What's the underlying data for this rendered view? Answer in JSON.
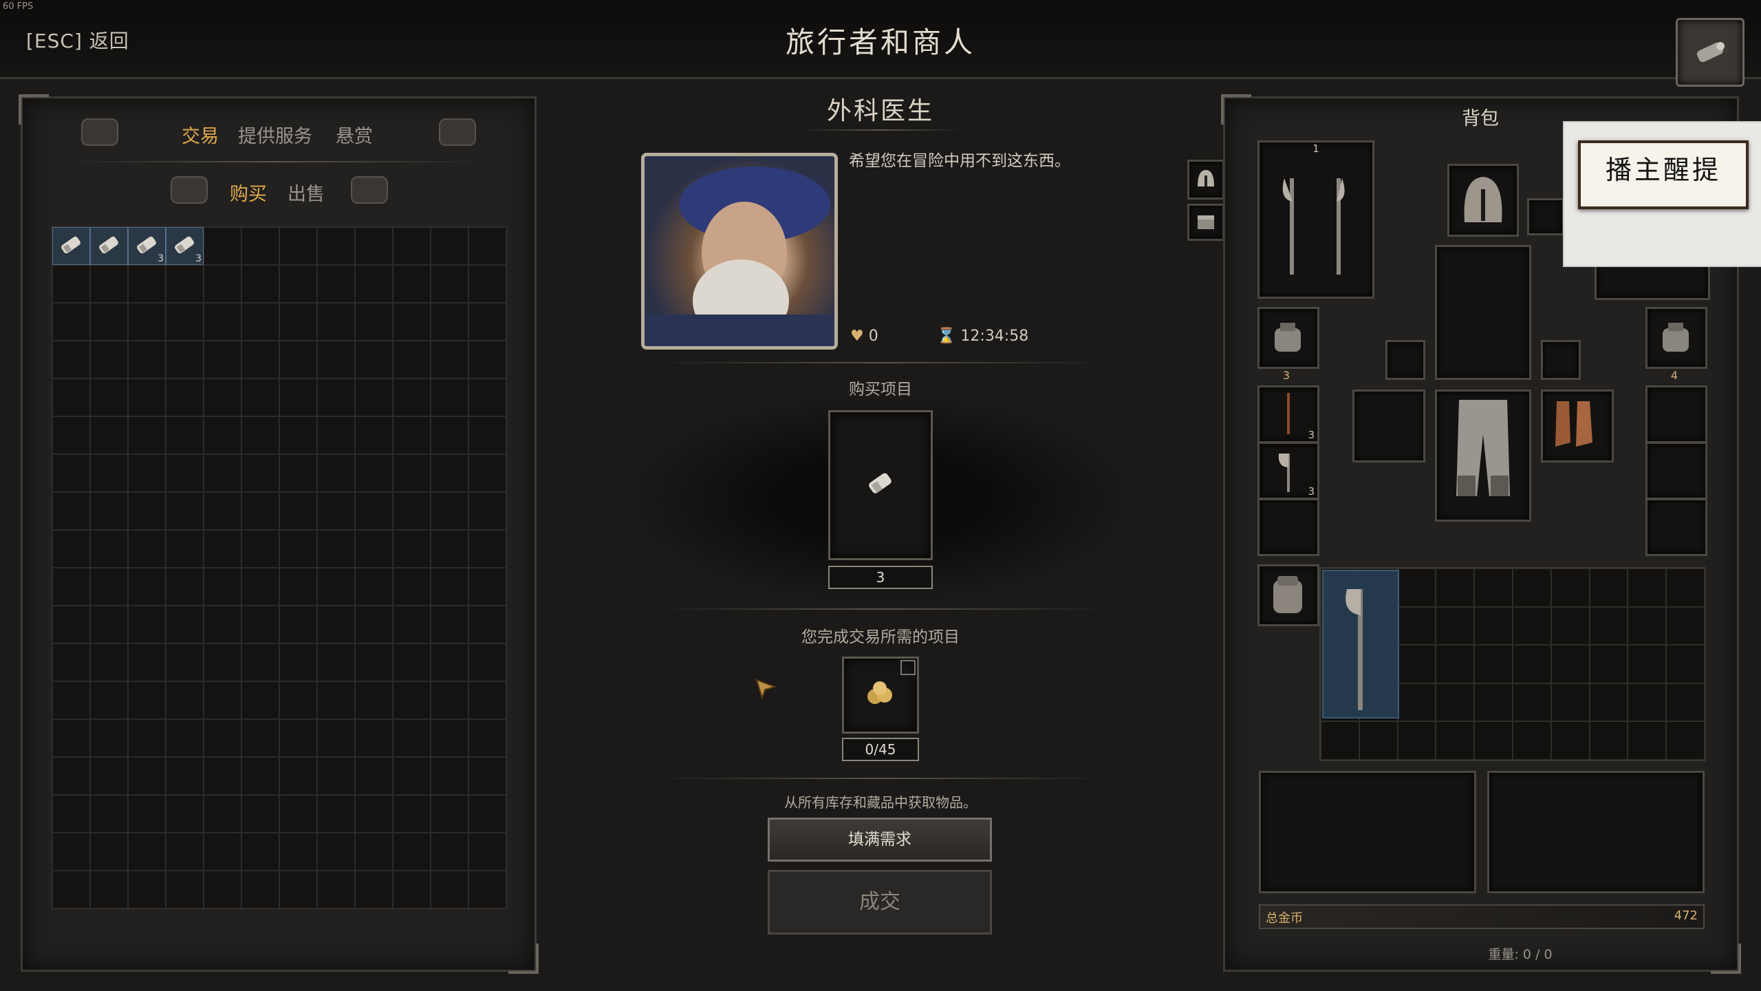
{
  "hud": {
    "fps": "60 FPS",
    "back": "[ESC] 返回",
    "title": "旅行者和商人"
  },
  "left_panel": {
    "tabs": [
      "交易",
      "提供服务",
      "悬赏"
    ],
    "active_tab": "交易",
    "subtabs": [
      "购买",
      "出售"
    ],
    "active_subtab": "购买",
    "grid": {
      "columns": 12,
      "rows": 18
    },
    "items": [
      {
        "name": "bandage-icon",
        "count": ""
      },
      {
        "name": "bandage-icon",
        "count": ""
      },
      {
        "name": "bandage-icon",
        "count": "3"
      },
      {
        "name": "bandage-icon",
        "count": "3"
      }
    ]
  },
  "npc": {
    "name": "外科医生",
    "quote": "希望您在冒险中用不到这东西。",
    "reputation": "0",
    "timer": "12:34:58"
  },
  "purchase": {
    "label": "购买项目",
    "item_icon": "bandage-icon",
    "quantity": "3"
  },
  "requirement": {
    "label": "您完成交易所需的项目",
    "item_icon": "gold-coins-icon",
    "progress": "0/45"
  },
  "actions": {
    "hint": "从所有库存和藏品中获取物品。",
    "fill": "填满需求",
    "deal": "成交"
  },
  "backpack": {
    "title": "背包",
    "slot_number_top": "1",
    "left_pouch_count": "3",
    "right_pouch_count": "4",
    "belt_counts": [
      "3",
      "3"
    ],
    "gold_label": "总金币",
    "gold_value": "472",
    "weight": "重量: 0 / 0",
    "bag_grid": {
      "columns": 10,
      "rows": 5
    }
  },
  "overlay": {
    "sign_text": "播主醒提"
  }
}
